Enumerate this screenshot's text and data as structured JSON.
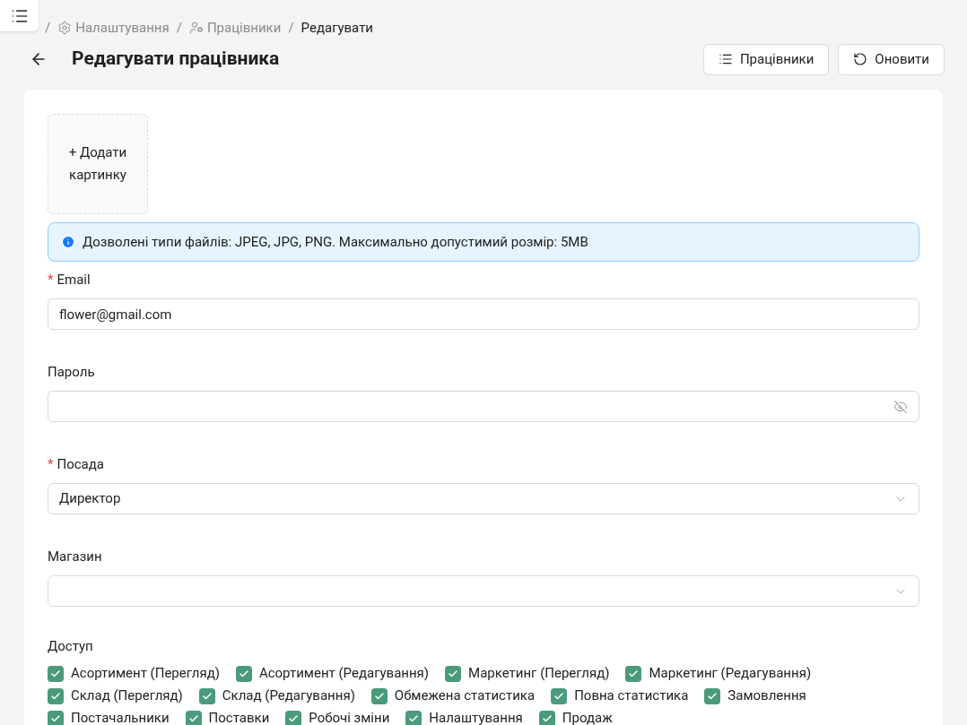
{
  "breadcrumb": [
    {
      "separator": "/",
      "label": "Налаштування",
      "current": false
    },
    {
      "separator": "/",
      "label": "Працівники",
      "current": false
    },
    {
      "separator": "/",
      "label": "Редагувати",
      "current": true
    }
  ],
  "header": {
    "title": "Редагувати працівника",
    "buttons": [
      {
        "label": "Працівники"
      },
      {
        "label": "Оновити"
      }
    ]
  },
  "upload": {
    "label": "+ Додати картинку"
  },
  "notice": {
    "text": "Дозволені типи файлів: JPEG, JPG, PNG. Максимально допустимий розмір: 5MB"
  },
  "fields": [
    {
      "label": "Email",
      "required_mark": "*",
      "kind": "text",
      "value": "flower@gmail.com"
    },
    {
      "label": "Пароль",
      "kind": "password"
    },
    {
      "label": "Посада",
      "required_mark": "*",
      "kind": "select",
      "value": "Директор"
    },
    {
      "label": "Магазин",
      "kind": "select"
    }
  ],
  "access": {
    "label": "Доступ",
    "rows": [
      [
        {
          "label": "Асортимент (Перегляд)",
          "checked": true
        },
        {
          "label": "Асортимент (Редагування)",
          "checked": true
        },
        {
          "label": "Маркетинг (Перегляд)",
          "checked": true
        },
        {
          "label": "Маркетинг (Редагування)",
          "checked": true
        }
      ],
      [
        {
          "label": "Склад (Перегляд)",
          "checked": true
        },
        {
          "label": "Склад (Редагування)",
          "checked": true
        },
        {
          "label": "Обмежена статистика",
          "checked": true
        },
        {
          "label": "Повна статистика",
          "checked": true
        },
        {
          "label": "Замовлення",
          "checked": true
        }
      ],
      [
        {
          "label": "Постачальники",
          "checked": true
        },
        {
          "label": "Поставки",
          "checked": true
        },
        {
          "label": "Робочі зміни",
          "checked": true
        },
        {
          "label": "Налаштування",
          "checked": true
        },
        {
          "label": "Продаж",
          "checked": true
        }
      ]
    ]
  }
}
